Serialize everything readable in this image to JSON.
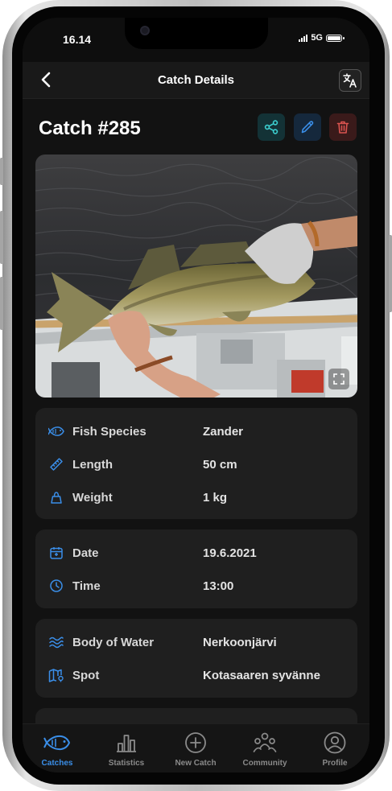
{
  "status": {
    "time": "16.14",
    "network": "5G"
  },
  "header": {
    "title": "Catch Details",
    "back_icon": "chevron-left-icon",
    "translate_icon": "translate-icon"
  },
  "catch": {
    "title": "Catch #285"
  },
  "actions": {
    "share_icon": "share-icon",
    "edit_icon": "pencil-icon",
    "delete_icon": "trash-icon"
  },
  "photo": {
    "expand_icon": "expand-icon"
  },
  "fish_card": {
    "species": {
      "label": "Fish Species",
      "value": "Zander"
    },
    "length": {
      "label": "Length",
      "value": "50 cm"
    },
    "weight": {
      "label": "Weight",
      "value": "1 kg"
    }
  },
  "date_card": {
    "date": {
      "label": "Date",
      "value": "19.6.2021"
    },
    "time": {
      "label": "Time",
      "value": "13:00"
    }
  },
  "location_card": {
    "water": {
      "label": "Body of Water",
      "value": "Nerkoonjärvi"
    },
    "spot": {
      "label": "Spot",
      "value": "Kotasaaren syvänne"
    }
  },
  "tabs": [
    {
      "label": "Catches",
      "icon": "fish-icon",
      "active": true
    },
    {
      "label": "Statistics",
      "icon": "bar-chart-icon",
      "active": false
    },
    {
      "label": "New Catch",
      "icon": "plus-circle-icon",
      "active": false
    },
    {
      "label": "Community",
      "icon": "people-icon",
      "active": false
    },
    {
      "label": "Profile",
      "icon": "user-circle-icon",
      "active": false
    }
  ],
  "colors": {
    "accent": "#3a8ee8",
    "share": "#3ccfd0",
    "delete": "#d9534f",
    "background": "#121212",
    "card": "#1f1f1f"
  }
}
